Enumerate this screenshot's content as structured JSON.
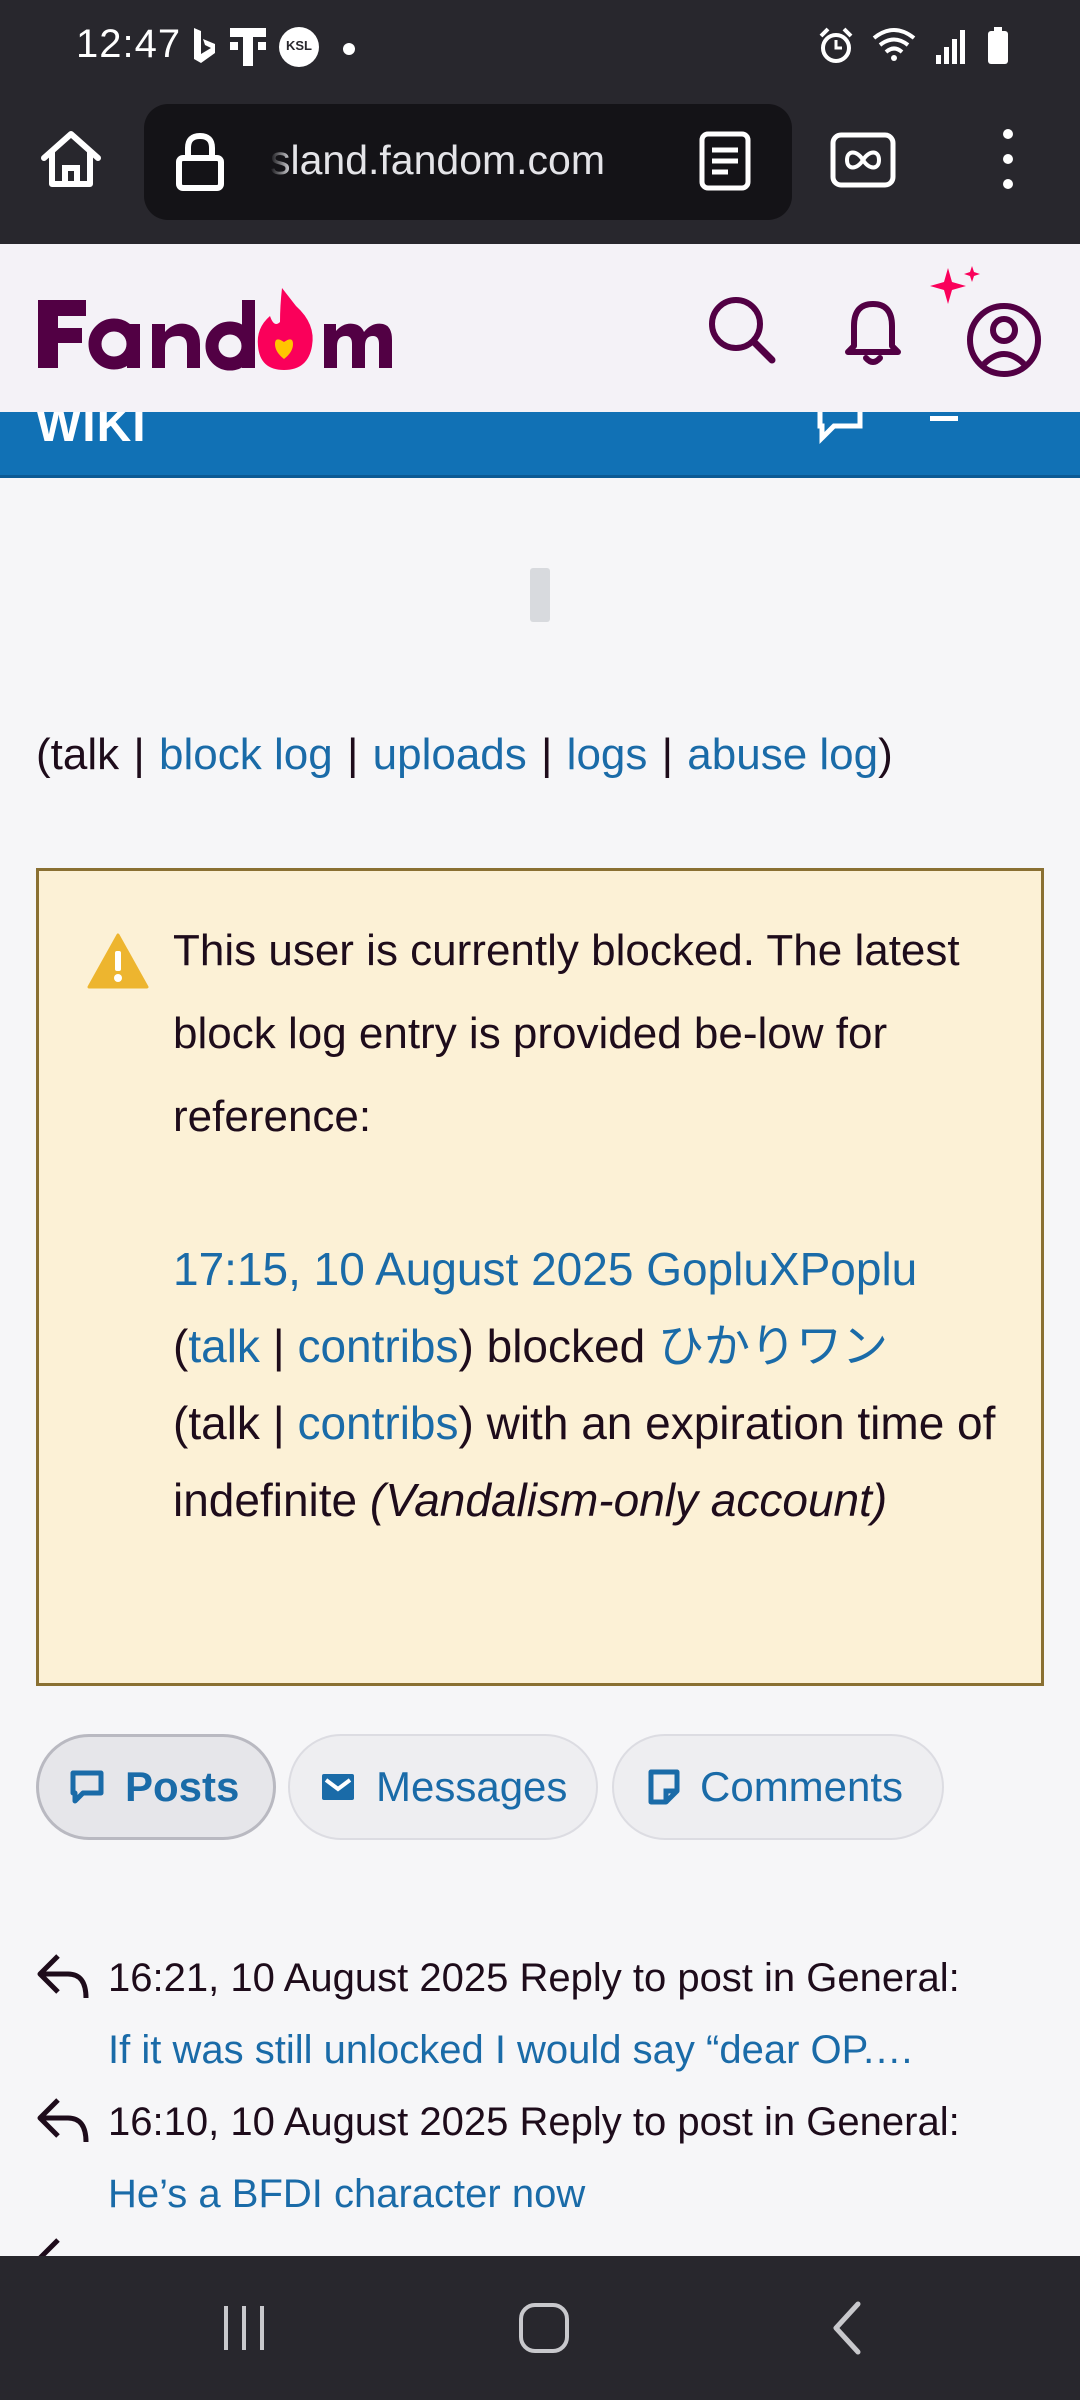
{
  "status_bar": {
    "time": "12:47",
    "icons": [
      "bing-icon",
      "t-mobile-icon",
      "ksl-icon",
      "dot-icon",
      "alarm-icon",
      "wifi-icon",
      "signal-icon",
      "battery-icon"
    ],
    "ksl_label": "KSL"
  },
  "browser": {
    "url": "sland.fandom.com",
    "icons": [
      "home-icon",
      "lock-icon",
      "reader-mode-icon",
      "tabs-icon",
      "overflow-menu-icon"
    ]
  },
  "header": {
    "logo": "Fandom",
    "brand_color": "#520044",
    "accent_color": "#fa005a"
  },
  "wiki_band": {
    "label": "WIKI",
    "color": "#1171b5"
  },
  "user_links": {
    "open_paren": "(",
    "talk": "talk",
    "sep": "|",
    "block_log": "block log",
    "uploads": "uploads",
    "logs": "logs",
    "abuse_log": "abuse log",
    "close_paren": ")"
  },
  "block_notice": {
    "message": "This user is currently blocked. The latest block log entry is provided be-low for reference:",
    "entry": {
      "timestamp": "17:15, 10 August 2025",
      "blocker": "GopluXPoplu",
      "open_paren": "(",
      "talk": "talk",
      "sep": "|",
      "contribs": "contribs",
      "close_blocked": ") blocked",
      "target": "ひかりワン",
      "talk_plain": "talk",
      "contribs2": "contribs",
      "expiry_text": ") with an expiration time of indefinite",
      "reason": "(Vandalism-only account)"
    }
  },
  "tabs": [
    {
      "label": "Posts",
      "active": true
    },
    {
      "label": "Messages",
      "active": false
    },
    {
      "label": "Comments",
      "active": false
    }
  ],
  "activity": [
    {
      "meta": "16:21, 10 August 2025 Reply to post in General:",
      "link": "If it was still unlocked I would say “dear OP.…"
    },
    {
      "meta": "16:10, 10 August 2025 Reply to post in General:",
      "link": "He’s a BFDI character now"
    }
  ],
  "nav_bar": {
    "icons": [
      "recent-apps-icon",
      "home-button-icon",
      "back-icon"
    ]
  }
}
